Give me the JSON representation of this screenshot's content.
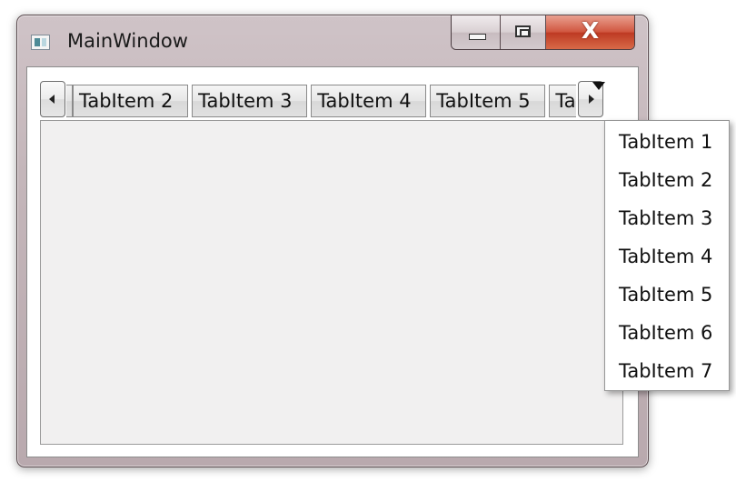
{
  "window": {
    "title": "MainWindow",
    "controls": {
      "close_glyph": "X"
    }
  },
  "icons": {
    "app": "window-icon",
    "minimize": "minimize-icon",
    "maximize": "maximize-icon",
    "close": "close-icon",
    "scroll_left": "chevron-left-icon",
    "scroll_right": "chevron-right-icon",
    "dropdown": "caret-down-icon"
  },
  "tabs": [
    {
      "label": "TabItem 2"
    },
    {
      "label": "TabItem 3"
    },
    {
      "label": "TabItem 4"
    },
    {
      "label": "TabItem 5"
    },
    {
      "label": "Tab"
    }
  ],
  "dropdown_menu": {
    "items": [
      {
        "label": "TabItem 1"
      },
      {
        "label": "TabItem 2"
      },
      {
        "label": "TabItem 3"
      },
      {
        "label": "TabItem 4"
      },
      {
        "label": "TabItem 5"
      },
      {
        "label": "TabItem 6"
      },
      {
        "label": "TabItem 7"
      }
    ]
  },
  "colors": {
    "window_frame": "#c4b6ba",
    "close_button": "#d0553e",
    "tab_content_bg": "#f1f0f0"
  }
}
